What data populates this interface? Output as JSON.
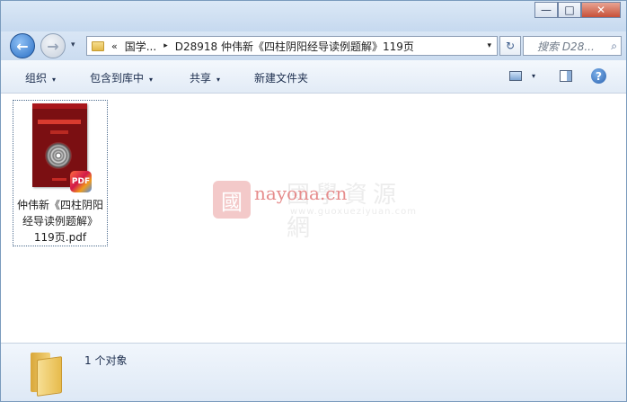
{
  "window": {
    "minimize_glyph": "—",
    "maximize_glyph": "□",
    "close_glyph": "✕"
  },
  "nav": {
    "back_glyph": "←",
    "forward_glyph": "→",
    "chevron_glyph": "«",
    "separator_glyph": "▸",
    "breadcrumb": [
      "国学...",
      "D28918 仲伟新《四柱阴阳经导读例题解》119页"
    ],
    "dropdown_glyph": "▾",
    "refresh_glyph": "↻",
    "search_placeholder": "搜索 D28...",
    "search_icon_glyph": "⌕"
  },
  "toolbar": {
    "organize": "组织",
    "include_in_library": "包含到库中",
    "share": "共享",
    "new_folder": "新建文件夹",
    "dropdown_glyph": "▾",
    "help_glyph": "?"
  },
  "file": {
    "name_lines": [
      "仲伟新《四柱阴阳",
      "经导读例题解》",
      "119页.pdf"
    ],
    "badge": "PDF"
  },
  "watermark": {
    "seal": "國",
    "cn_text": "國學資源網",
    "en_text": "nayona.cn",
    "url": "www.guoxueziyuan.com"
  },
  "status": {
    "count_text": "1 个对象"
  }
}
